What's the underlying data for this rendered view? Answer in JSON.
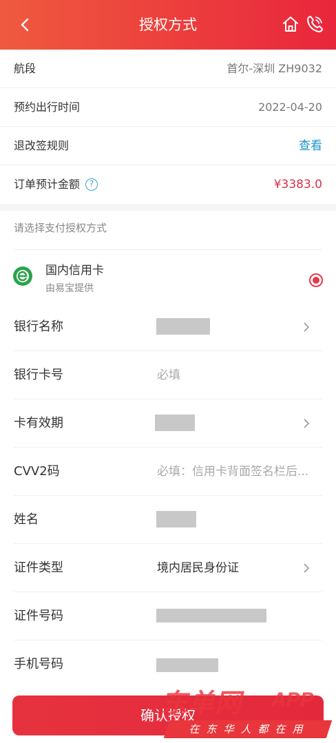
{
  "header": {
    "title": "授权方式",
    "gradient_start": "#ef5a3e",
    "gradient_end": "#e9263c",
    "icons": [
      "back-arrow-icon",
      "home-icon",
      "phone-icon"
    ]
  },
  "trip": {
    "segment_label": "航段",
    "segment_value": "首尔-深圳  ZH9032",
    "date_label": "预约出行时间",
    "date_value": "2022-04-20",
    "rules_label": "退改签规则",
    "rules_link": "查看",
    "amount_label": "订单预计金额",
    "amount_help": "?",
    "amount_value": "¥3383.0"
  },
  "payment": {
    "section_title": "请选择支付授权方式",
    "method_name": "国内信用卡",
    "method_provider": "由易宝提供",
    "method_selected": true,
    "fields": {
      "bank_name_label": "银行名称",
      "card_number_label": "银行卡号",
      "card_number_placeholder": "必填",
      "expiry_label": "卡有效期",
      "cvv_label": "CVV2码",
      "cvv_placeholder": "必填：信用卡背面签名栏后...",
      "name_label": "姓名",
      "id_type_label": "证件类型",
      "id_type_value": "境内居民身份证",
      "id_number_label": "证件号码",
      "phone_label": "手机号码"
    }
  },
  "confirm_button": "确认授权",
  "watermark": {
    "brand": "东单网",
    "app": "APP",
    "slogan": "在东华人都在用"
  },
  "colors": {
    "accent": "#e4283c",
    "link": "#1b94c9",
    "amount": "#d8304a"
  }
}
